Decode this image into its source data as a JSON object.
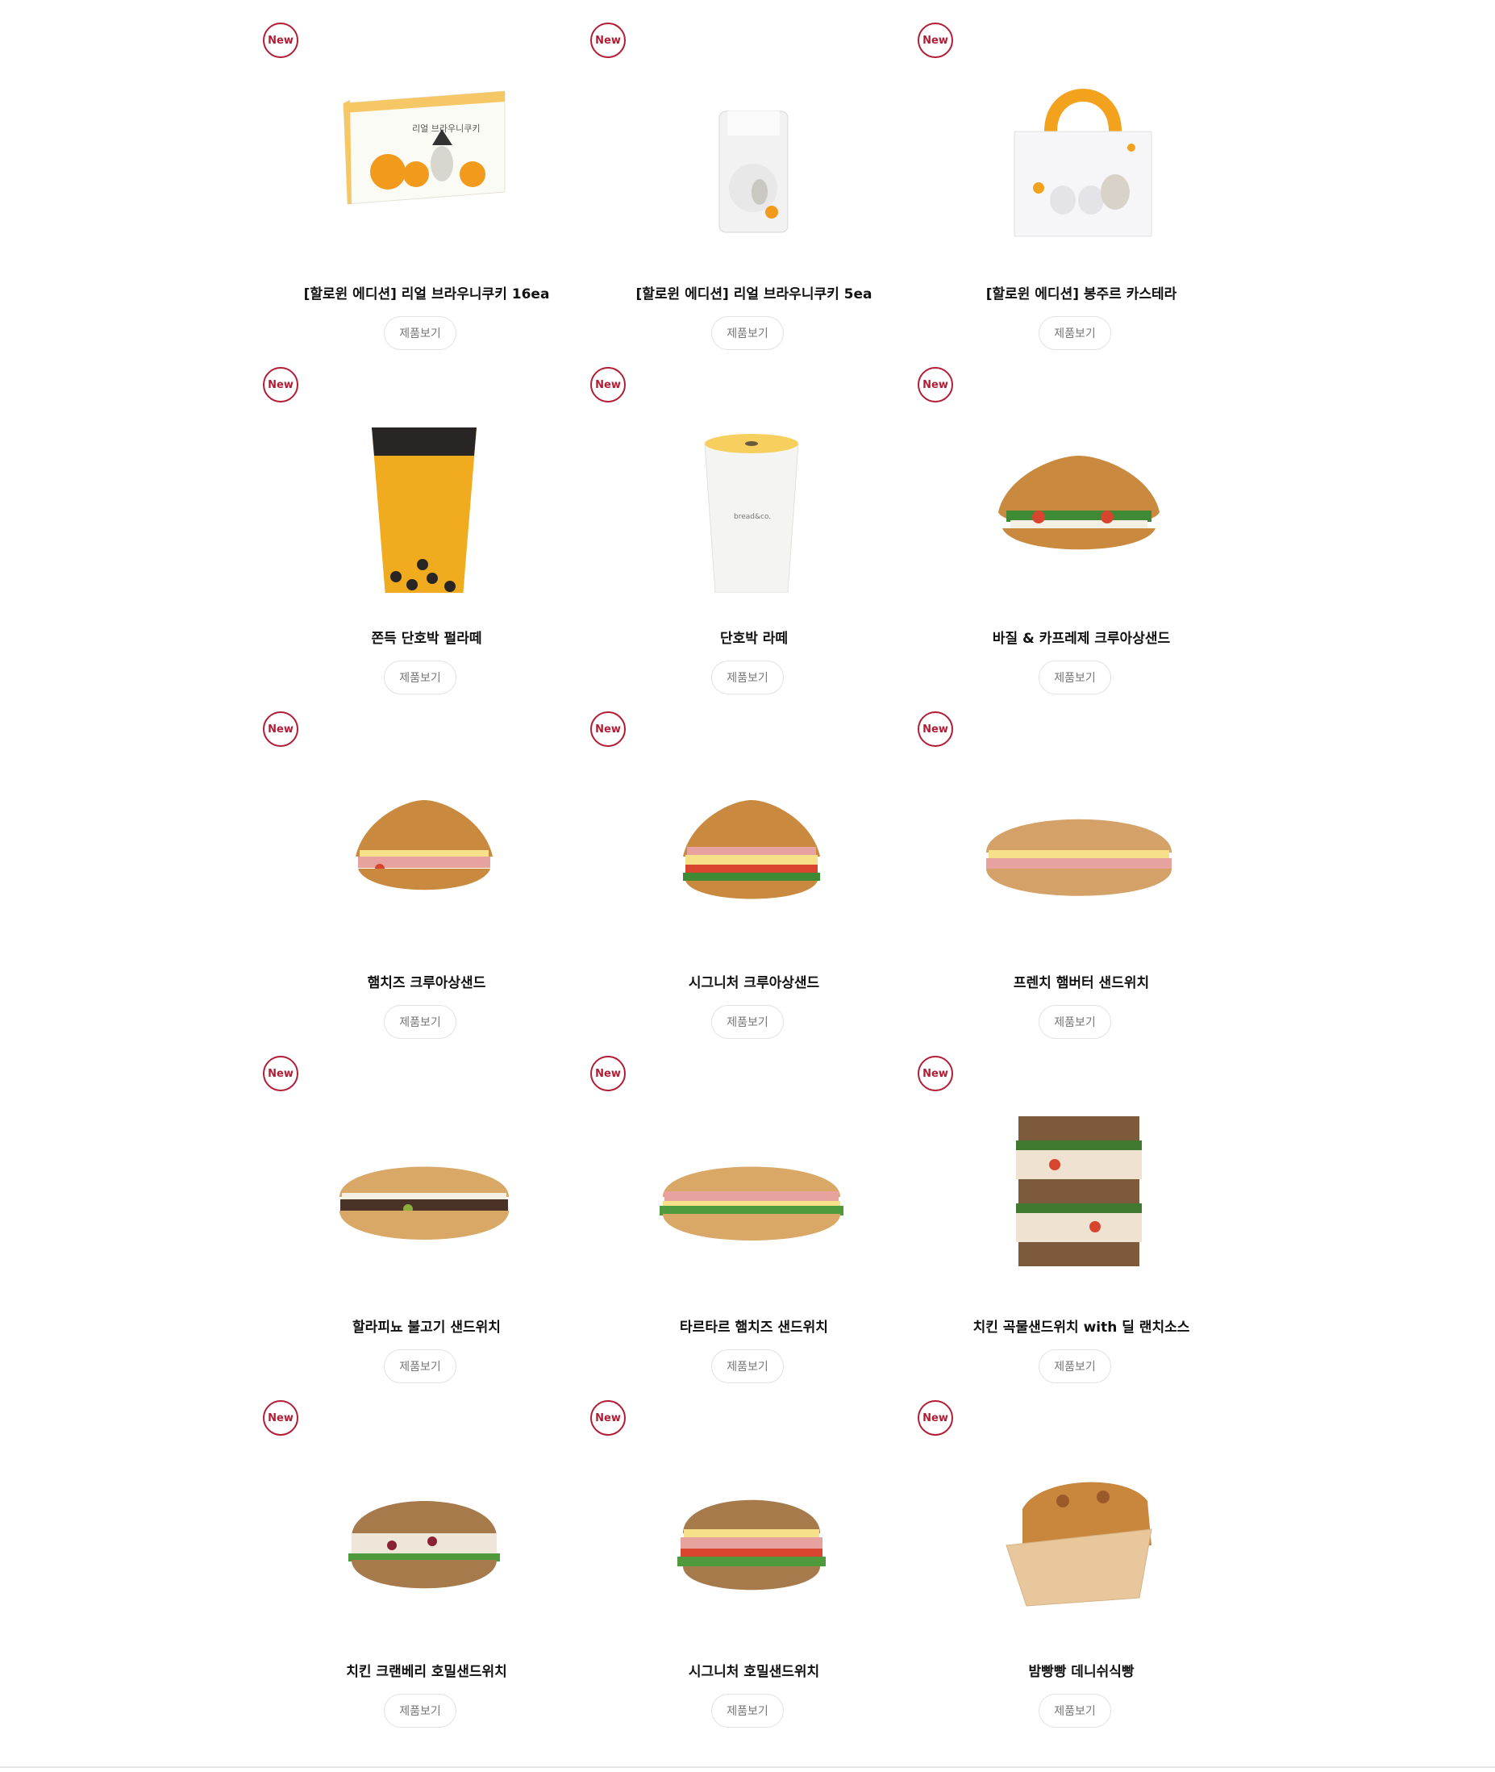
{
  "badge_label": "New",
  "button_label": "제품보기",
  "colors": {
    "badge": "#b01d34",
    "button_border": "#e2e2e2",
    "button_text": "#777777"
  },
  "products": [
    {
      "name": "[할로윈 에디션] 리얼 브라우니쿠키 16ea",
      "image": "halloween-cookie-box"
    },
    {
      "name": "[할로윈 에디션] 리얼 브라우니쿠키 5ea",
      "image": "halloween-cookie-bag"
    },
    {
      "name": "[할로윈 에디션] 봉주르 카스테라",
      "image": "castella-box"
    },
    {
      "name": "쫀득 단호박 펄라떼",
      "image": "pumpkin-pearl-latte"
    },
    {
      "name": "단호박 라떼",
      "image": "pumpkin-latte-cup"
    },
    {
      "name": "바질 & 카프레제 크루아상샌드",
      "image": "basil-caprese-croissant"
    },
    {
      "name": "햄치즈 크루아상샌드",
      "image": "ham-cheese-croissant"
    },
    {
      "name": "시그니처 크루아상샌드",
      "image": "signature-croissant"
    },
    {
      "name": "프렌치 햄버터 샌드위치",
      "image": "french-ham-butter-sandwich"
    },
    {
      "name": "할라피뇨 불고기 샌드위치",
      "image": "jalapeno-bulgogi-sandwich"
    },
    {
      "name": "타르타르 햄치즈 샌드위치",
      "image": "tartar-ham-cheese-sandwich"
    },
    {
      "name": "치킨 곡물샌드위치 with 딜 랜치소스",
      "image": "chicken-grain-sandwich"
    },
    {
      "name": "치킨 크랜베리 호밀샌드위치",
      "image": "chicken-cranberry-rye-sandwich"
    },
    {
      "name": "시그니처 호밀샌드위치",
      "image": "signature-rye-sandwich"
    },
    {
      "name": "밤빵빵 데니쉬식빵",
      "image": "chestnut-danish-bread"
    }
  ]
}
